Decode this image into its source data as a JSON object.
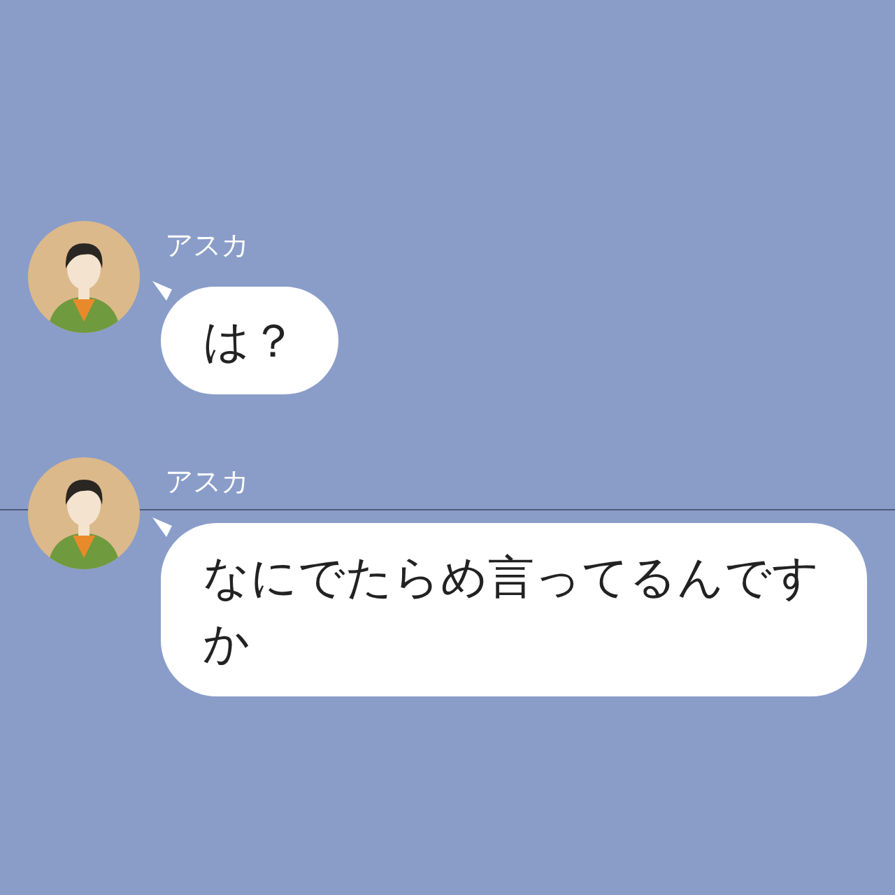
{
  "messages": [
    {
      "sender": "アスカ",
      "text": "は？"
    },
    {
      "sender": "アスカ",
      "text": "なにでたらめ言ってるんですか"
    }
  ]
}
